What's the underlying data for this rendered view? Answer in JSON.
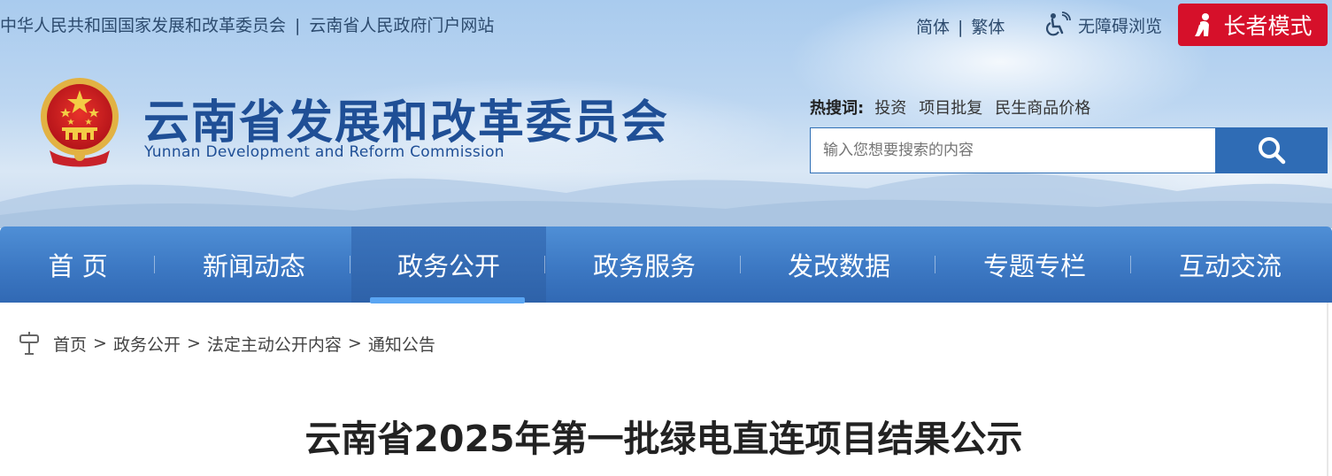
{
  "top_links": {
    "link1": "中华人民共和国国家发展和改革委员会",
    "separator": "|",
    "link2": "云南省人民政府门户网站"
  },
  "lang": {
    "simplified": "简体",
    "separator": "|",
    "traditional": "繁体"
  },
  "accessibility_label": "无障碍浏览",
  "elder_mode_label": "长者模式",
  "site": {
    "title": "云南省发展和改革委员会",
    "subtitle": "Yunnan Development and Reform Commission"
  },
  "hot_words": {
    "label": "热搜词:",
    "items": [
      "投资",
      "项目批复",
      "民生商品价格"
    ]
  },
  "search": {
    "placeholder": "输入您想要搜索的内容"
  },
  "nav": {
    "items": [
      "首 页",
      "新闻动态",
      "政务公开",
      "政务服务",
      "发改数据",
      "专题专栏",
      "互动交流"
    ],
    "active": "政务公开"
  },
  "breadcrumb": {
    "items": [
      "首页",
      "政务公开",
      "法定主动公开内容",
      "通知公告"
    ],
    "separator": ">"
  },
  "article": {
    "title": "云南省2025年第一批绿电直连项目结果公示"
  },
  "colors": {
    "brand_blue": "#1f4f96",
    "nav_blue": "#3c78c3",
    "elder_red": "#d6102a",
    "search_blue": "#2f6cb5"
  },
  "icons": {
    "accessibility": "wheelchair-icon",
    "elder": "elder-person-icon",
    "search": "search-icon",
    "breadcrumb": "location-signpost-icon",
    "emblem": "national-emblem-icon"
  }
}
